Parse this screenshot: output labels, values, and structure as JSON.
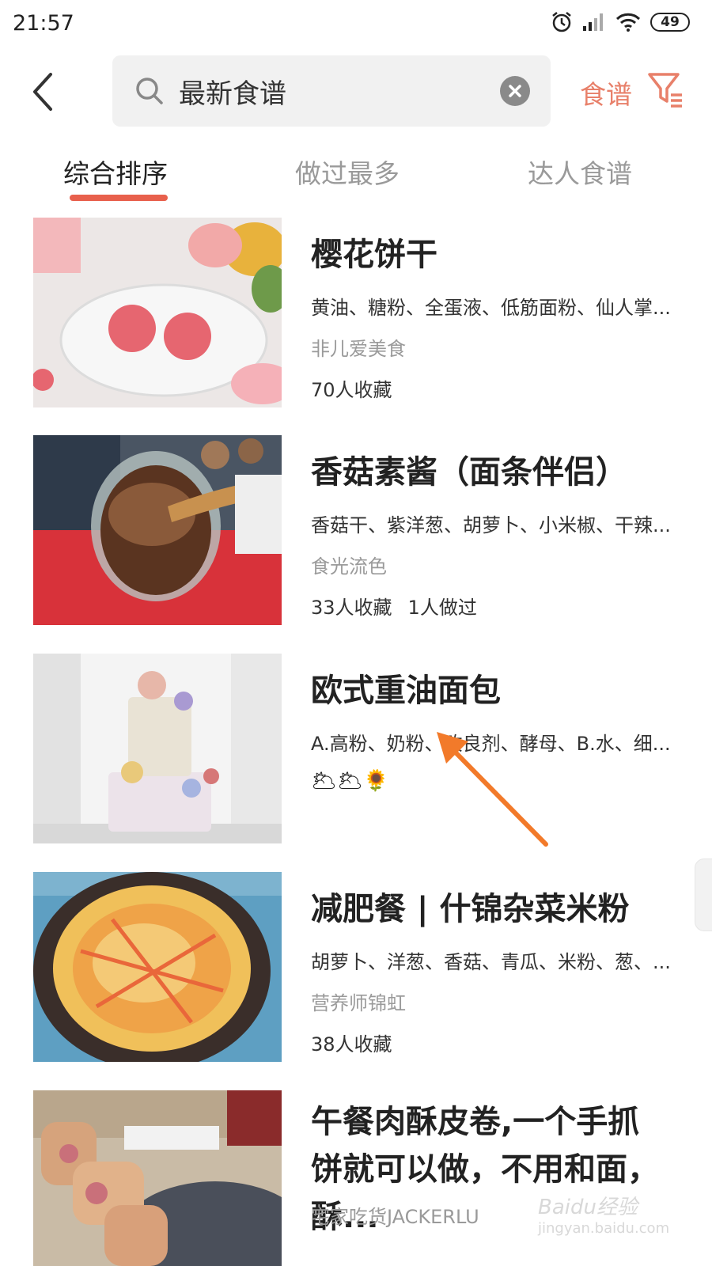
{
  "status_bar": {
    "time": "21:57",
    "battery": "49"
  },
  "search": {
    "value": "最新食谱",
    "filter_label": "食谱"
  },
  "tabs": [
    {
      "label": "综合排序",
      "active": true
    },
    {
      "label": "做过最多",
      "active": false
    },
    {
      "label": "达人食谱",
      "active": false
    }
  ],
  "recipes": [
    {
      "title": "樱花饼干",
      "ingredients": "黄油、糖粉、全蛋液、低筋面粉、仙人掌...",
      "author": "非儿爱美食",
      "stats": [
        "70人收藏"
      ]
    },
    {
      "title": "香菇素酱（面条伴侣）",
      "ingredients": "香菇干、紫洋葱、胡萝卜、小米椒、干辣...",
      "author": "食光流色",
      "stats": [
        "33人收藏",
        "1人做过"
      ]
    },
    {
      "title": "欧式重油面包",
      "ingredients": "A.高粉、奶粉、改良剂、酵母、B.水、细...",
      "author_emoji": "🌥🌥🌻",
      "stats": []
    },
    {
      "title": "减肥餐 | 什锦杂菜米粉",
      "ingredients": "胡萝卜、洋葱、香菇、青瓜、米粉、葱、...",
      "author": "营养师锦虹",
      "stats": [
        "38人收藏"
      ]
    },
    {
      "title": "午餐肉酥皮卷,一个手抓饼就可以做，不用和面，酥...",
      "author": "宅家吃货JACKERLU"
    }
  ],
  "watermark": {
    "brand": "Baidu经验",
    "url": "jingyan.baidu.com"
  },
  "colors": {
    "accent": "#e8604c",
    "link": "#e8806a"
  }
}
